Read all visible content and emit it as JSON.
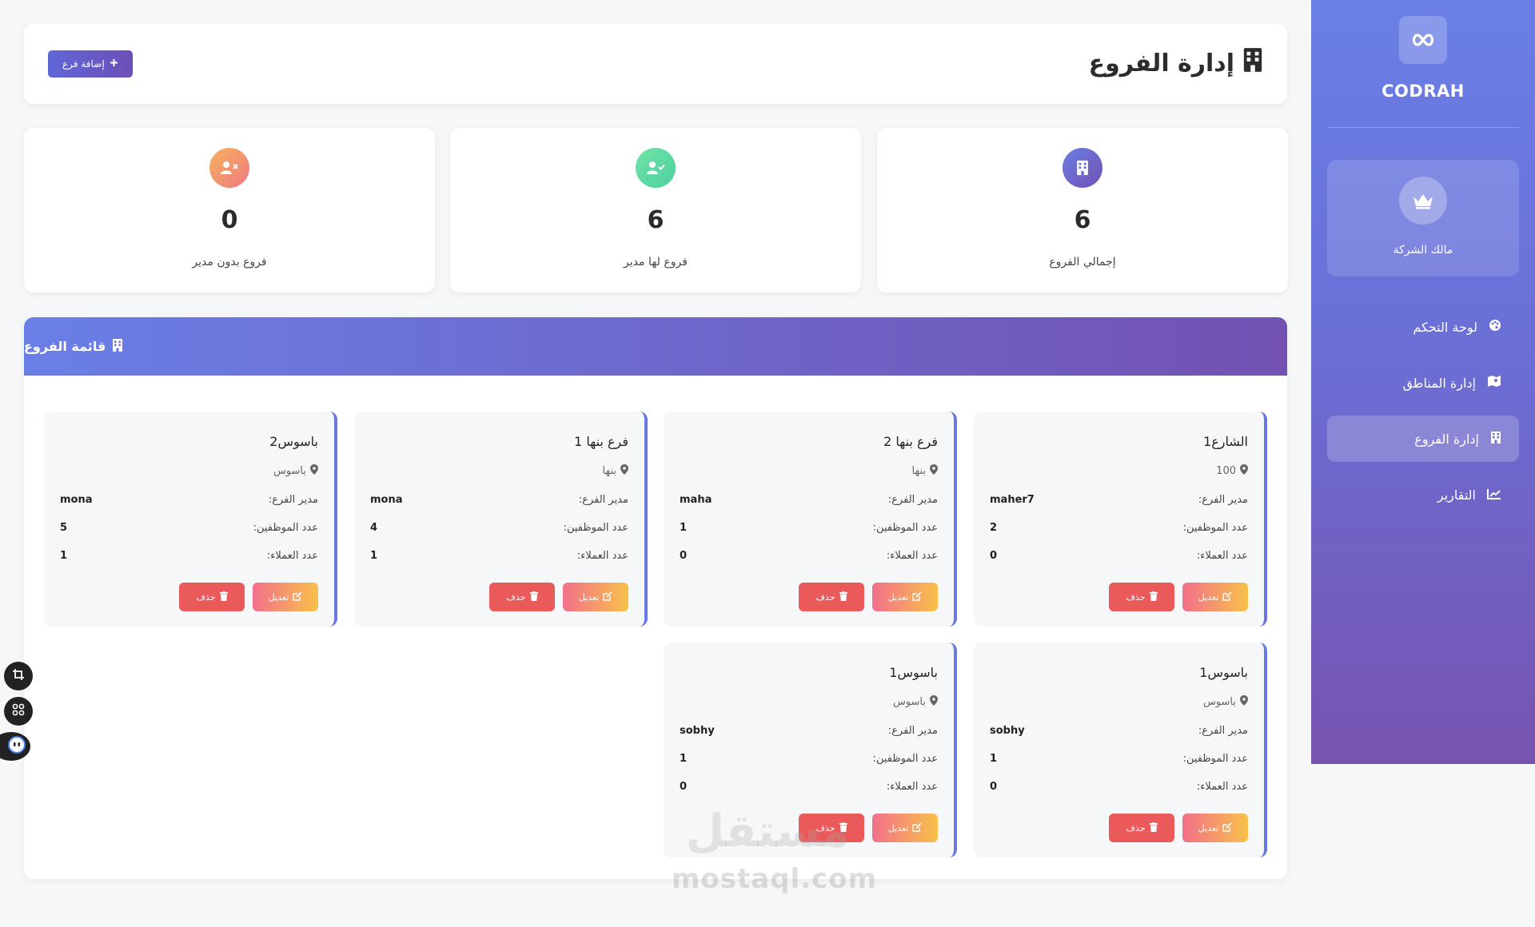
{
  "sidebar": {
    "brand": "CODRAH",
    "owner_label": "مالك الشركة",
    "items": [
      {
        "label": "لوحة التحكم",
        "icon": "palette-icon",
        "active": false
      },
      {
        "label": "إدارة المناطق",
        "icon": "map-icon",
        "active": false
      },
      {
        "label": "إدارة الفروع",
        "icon": "building-icon",
        "active": true
      },
      {
        "label": "التقارير",
        "icon": "chart-line-icon",
        "active": false
      }
    ]
  },
  "header": {
    "title": "إدارة الفروع",
    "add_button": "إضافة فرع"
  },
  "stats": [
    {
      "label": "إجمالي الفروع",
      "value": "6",
      "icon": "building-icon",
      "color": "#6b6fd6"
    },
    {
      "label": "فروع لها مدير",
      "value": "6",
      "icon": "user-check-icon",
      "color": "#5fd99a"
    },
    {
      "label": "فروع بدون مدير",
      "value": "0",
      "icon": "user-x-icon",
      "color": "#f38a6e"
    }
  ],
  "list": {
    "title": "قائمة الفروع",
    "labels": {
      "manager": "مدير الفرع:",
      "employees": "عدد الموظفين:",
      "clients": "عدد العملاء:",
      "edit": "تعديل",
      "delete": "حذف"
    },
    "branches": [
      {
        "name": "الشارع1",
        "location": "100",
        "manager": "maher7",
        "employees": "2",
        "clients": "0"
      },
      {
        "name": "فرع بنها 2",
        "location": "بنها",
        "manager": "maha",
        "employees": "1",
        "clients": "0"
      },
      {
        "name": "فرع بنها 1",
        "location": "بنها",
        "manager": "mona",
        "employees": "4",
        "clients": "1"
      },
      {
        "name": "باسوس2",
        "location": "باسوس",
        "manager": "mona",
        "employees": "5",
        "clients": "1"
      },
      {
        "name": "باسوس1",
        "location": "باسوس",
        "manager": "sobhy",
        "employees": "1",
        "clients": "0"
      },
      {
        "name": "باسوس1",
        "location": "باسوس",
        "manager": "sobhy",
        "employees": "1",
        "clients": "0"
      }
    ]
  },
  "watermark": {
    "arabic": "مستقل",
    "latin": "mostaql.com"
  }
}
